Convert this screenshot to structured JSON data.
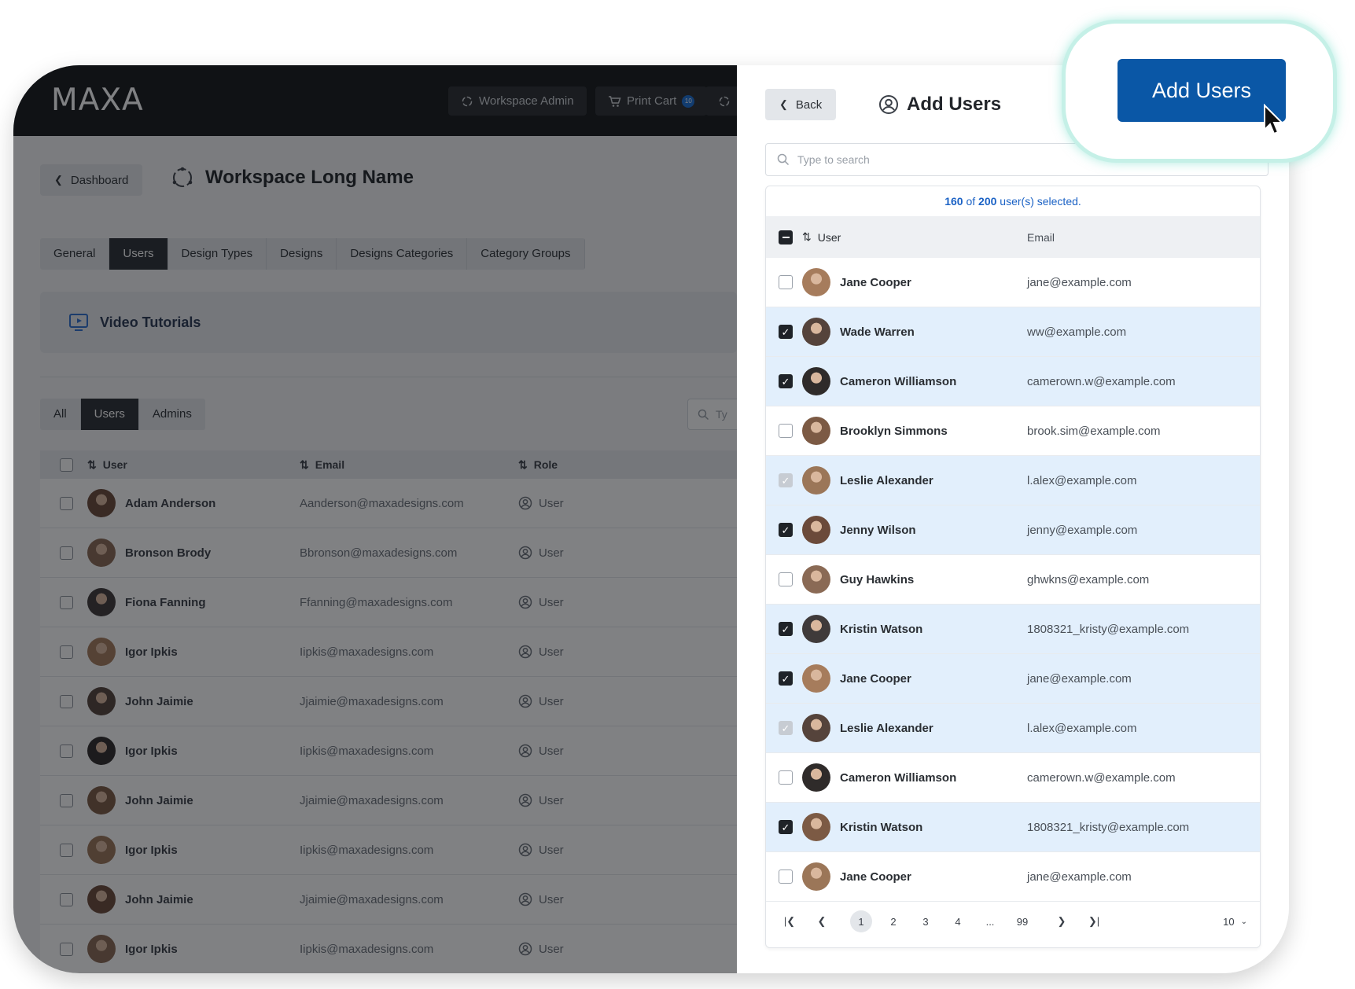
{
  "app": {
    "logo": "MAXA"
  },
  "topbar": {
    "workspace_admin": "Workspace Admin",
    "print_cart": "Print Cart",
    "cart_count": "10"
  },
  "workspace": {
    "back_label": "Dashboard",
    "title": "Workspace Long Name",
    "tabs": [
      "General",
      "Users",
      "Design Types",
      "Designs",
      "Designs Categories",
      "Category Groups"
    ],
    "active_tab": "Users",
    "video_tutorials": "Video Tutorials",
    "filters": [
      "All",
      "Users",
      "Admins"
    ],
    "active_filter": "Users",
    "search_placeholder": "Ty",
    "columns": {
      "user": "User",
      "email": "Email",
      "role": "Role"
    },
    "rows": [
      {
        "name": "Adam Anderson",
        "email": "Aanderson@maxadesigns.com",
        "role": "User"
      },
      {
        "name": "Bronson Brody",
        "email": "Bbronson@maxadesigns.com",
        "role": "User"
      },
      {
        "name": "Fiona Fanning",
        "email": "Ffanning@maxadesigns.com",
        "role": "User"
      },
      {
        "name": "Igor Ipkis",
        "email": "Iipkis@maxadesigns.com",
        "role": "User"
      },
      {
        "name": "John Jaimie",
        "email": "Jjaimie@maxadesigns.com",
        "role": "User"
      },
      {
        "name": "Igor Ipkis",
        "email": "Iipkis@maxadesigns.com",
        "role": "User"
      },
      {
        "name": "John Jaimie",
        "email": "Jjaimie@maxadesigns.com",
        "role": "User"
      },
      {
        "name": "Igor Ipkis",
        "email": "Iipkis@maxadesigns.com",
        "role": "User"
      },
      {
        "name": "John Jaimie",
        "email": "Jjaimie@maxadesigns.com",
        "role": "User"
      },
      {
        "name": "Igor Ipkis",
        "email": "Iipkis@maxadesigns.com",
        "role": "User"
      }
    ]
  },
  "panel": {
    "back_label": "Back",
    "title": "Add Users",
    "search_placeholder": "Type to search",
    "selection": {
      "selected": "160",
      "of": "of",
      "total": "200",
      "suffix": "user(s) selected."
    },
    "columns": {
      "user": "User",
      "email": "Email"
    },
    "rows": [
      {
        "name": "Jane Cooper",
        "email": "jane@example.com",
        "state": "unchecked"
      },
      {
        "name": "Wade Warren",
        "email": "ww@example.com",
        "state": "checked"
      },
      {
        "name": "Cameron Williamson",
        "email": "camerown.w@example.com",
        "state": "checked"
      },
      {
        "name": "Brooklyn Simmons",
        "email": "brook.sim@example.com",
        "state": "unchecked"
      },
      {
        "name": "Leslie Alexander",
        "email": "l.alex@example.com",
        "state": "disabled"
      },
      {
        "name": "Jenny Wilson",
        "email": "jenny@example.com",
        "state": "checked"
      },
      {
        "name": "Guy Hawkins",
        "email": "ghwkns@example.com",
        "state": "unchecked"
      },
      {
        "name": "Kristin Watson",
        "email": "1808321_kristy@example.com",
        "state": "checked"
      },
      {
        "name": "Jane Cooper",
        "email": "jane@example.com",
        "state": "checked"
      },
      {
        "name": "Leslie Alexander",
        "email": "l.alex@example.com",
        "state": "disabled"
      },
      {
        "name": "Cameron Williamson",
        "email": "camerown.w@example.com",
        "state": "unchecked"
      },
      {
        "name": "Kristin Watson",
        "email": "1808321_kristy@example.com",
        "state": "checked"
      },
      {
        "name": "Jane Cooper",
        "email": "jane@example.com",
        "state": "unchecked"
      }
    ],
    "pagination": {
      "pages": [
        "1",
        "2",
        "3",
        "4",
        "...",
        "99"
      ],
      "current": "1",
      "per_page": "10"
    }
  },
  "callout": {
    "add_users_label": "Add Users"
  },
  "colors": {
    "primary": "#0a57a6",
    "selected_row": "#e2effc",
    "accent_link": "#1b62c5",
    "callout_glow": "#c5f0e7"
  }
}
